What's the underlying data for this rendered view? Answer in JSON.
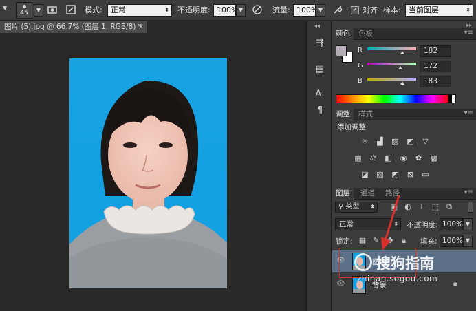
{
  "options_bar": {
    "brush_size": "45",
    "mode_label": "模式:",
    "mode_value": "正常",
    "opacity_label": "不透明度:",
    "opacity_value": "100%",
    "flow_label": "流量:",
    "flow_value": "100%",
    "align_label": "对齐",
    "align_checked": "✓",
    "sample_label": "样本:",
    "sample_value": "当前图层"
  },
  "document": {
    "tab_title": "图片 (5).jpg @ 66.7% (图层 1, RGB/8) *",
    "tab_close": "×"
  },
  "color_panel": {
    "tabs": [
      "颜色",
      "色板"
    ],
    "channels": [
      {
        "label": "R",
        "value": "182",
        "pos": 0.714
      },
      {
        "label": "G",
        "value": "172",
        "pos": 0.675
      },
      {
        "label": "B",
        "value": "183",
        "pos": 0.718
      }
    ],
    "foreground": "#b6acb7",
    "background": "#ffffff"
  },
  "adjust_panel": {
    "tabs": [
      "调整",
      "样式"
    ],
    "title": "添加调整"
  },
  "layers_panel": {
    "tabs": [
      "图层",
      "通道",
      "路径"
    ],
    "filter_label": "类型",
    "blend_mode": "正常",
    "opacity_label": "不透明度:",
    "opacity_value": "100%",
    "lock_label": "锁定:",
    "fill_label": "填充:",
    "fill_value": "100%",
    "layers": [
      {
        "name": "图层 1",
        "selected": true
      },
      {
        "name": "背景",
        "selected": false
      }
    ]
  },
  "watermark": {
    "brand": "搜狗指南",
    "url": "zhinan.sogou.com"
  },
  "colors": {
    "accent_red": "#d9302b",
    "panel_bg": "#3b3b3b"
  }
}
